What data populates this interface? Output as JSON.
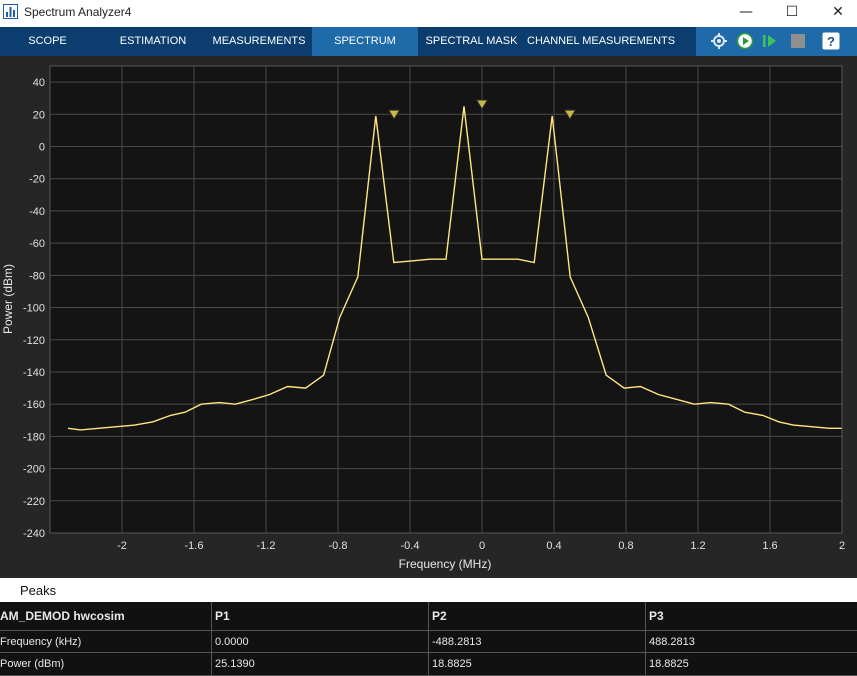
{
  "window": {
    "title": "Spectrum Analyzer4",
    "minimize": "—",
    "maximize": "☐",
    "close": "✕"
  },
  "toolbar": {
    "tabs": [
      "SCOPE",
      "ESTIMATION",
      "MEASUREMENTS",
      "SPECTRUM",
      "SPECTRAL MASK",
      "CHANNEL MEASUREMENTS"
    ],
    "active_tab": "SPECTRUM",
    "controls": [
      "settings-icon",
      "run-icon",
      "step-forward-icon",
      "stop-icon",
      "help-icon"
    ],
    "help_label": "?"
  },
  "chart_data": {
    "type": "line",
    "xlabel": "Frequency (MHz)",
    "ylabel": "Power (dBm)",
    "xlim": [
      -2.4,
      2.0
    ],
    "ylim": [
      -240,
      50
    ],
    "x_ticks": [
      "-2",
      "-1.6",
      "-1.2",
      "-0.8",
      "-0.4",
      "0",
      "0.4",
      "0.8",
      "1.2",
      "1.6",
      "2"
    ],
    "y_ticks": [
      "40",
      "20",
      "0",
      "-20",
      "-40",
      "-60",
      "-80",
      "-100",
      "-120",
      "-140",
      "-160",
      "-180",
      "-200",
      "-220",
      "-240"
    ],
    "grid": true,
    "colors": {
      "background": "#141414",
      "trace": "#ffe680",
      "grid": "#4a4a4a",
      "marker": "#c9b84a"
    },
    "series": [
      {
        "x": [
          -2.3,
          -2.23,
          -2.13,
          -2.03,
          -1.93,
          -1.83,
          -1.73,
          -1.65,
          -1.56,
          -1.46,
          -1.37,
          -1.27,
          -1.18,
          -1.08,
          -0.98,
          -0.88,
          -0.79,
          -0.69,
          -0.59,
          -0.49,
          -0.39,
          -0.29,
          -0.2,
          -0.1,
          0.0,
          0.1,
          0.2,
          0.29,
          0.39,
          0.49,
          0.59,
          0.69,
          0.79,
          0.88,
          0.98,
          1.08,
          1.18,
          1.27,
          1.37,
          1.46,
          1.56,
          1.65,
          1.73,
          1.83,
          1.93,
          2.0
        ],
        "y": [
          -175,
          -176,
          -175,
          -174,
          -173,
          -171,
          -167,
          -165,
          -160,
          -159,
          -160,
          -157,
          -154,
          -149,
          -150,
          -142,
          -106,
          -81,
          19,
          -72,
          -71,
          -70,
          -70,
          25,
          -70,
          -70,
          -70,
          -72,
          19,
          -81,
          -106,
          -142,
          -150,
          -149,
          -154,
          -157,
          -160,
          -159,
          -160,
          -165,
          -167,
          -171,
          -173,
          -174,
          -175,
          -175
        ]
      }
    ],
    "markers": [
      {
        "x": -0.4883,
        "y": 18.8825
      },
      {
        "x": 0.0,
        "y": 25.139
      },
      {
        "x": 0.4883,
        "y": 18.8825
      }
    ]
  },
  "peaks_panel": {
    "title": "Peaks",
    "columns": [
      "AM_DEMOD hwcosim",
      "P1",
      "P2",
      "P3"
    ],
    "rows": [
      [
        "Frequency (kHz)",
        "0.0000",
        "-488.2813",
        "488.2813"
      ],
      [
        "Power (dBm)",
        "25.1390",
        "18.8825",
        "18.8825"
      ]
    ]
  }
}
